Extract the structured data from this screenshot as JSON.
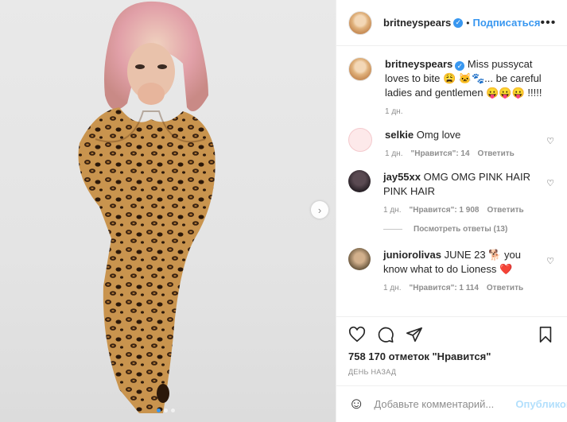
{
  "header": {
    "username": "britneyspears",
    "separator": "•",
    "follow_label": "Подписаться",
    "more_icon": "more-horizontal-icon"
  },
  "caption": {
    "username": "britneyspears",
    "text": "Miss pussycat loves to bite 😩 🐱🐾... be careful ladies and gentlemen 😛😛😛 !!!!!",
    "time": "1 дн."
  },
  "comments": [
    {
      "username": "selkie",
      "text": "Omg love",
      "time": "1 дн.",
      "likes": "\"Нравится\": 14",
      "reply": "Ответить"
    },
    {
      "username": "jay55xx",
      "text": "OMG OMG PINK HAIR PINK HAIR",
      "time": "1 дн.",
      "likes": "\"Нравится\": 1 908",
      "reply": "Ответить",
      "view_replies": "Посмотреть ответы (13)"
    },
    {
      "username": "juniorolivas",
      "text": "JUNE 23 🐕 you know what to do Lioness ❤️",
      "time": "1 дн.",
      "likes": "\"Нравится\": 1 114",
      "reply": "Ответить"
    }
  ],
  "actions": {
    "likes_text": "758 170 отметок \"Нравится\"",
    "date": "ДЕНЬ НАЗАД"
  },
  "add_comment": {
    "placeholder": "Добавьте комментарий...",
    "publish_label": "Опубликовать"
  },
  "media": {
    "carousel_dots": 3,
    "active_dot": 1
  },
  "colors": {
    "accent": "#3897f0",
    "publish_disabled": "#b2dffc",
    "muted": "#8e8e8e"
  }
}
